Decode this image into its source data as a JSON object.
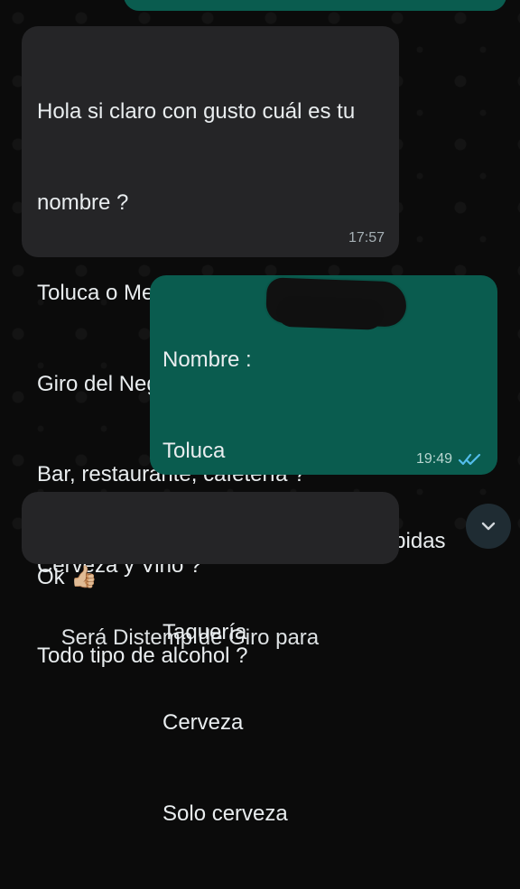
{
  "messages": [
    {
      "lines": [
        "Hola si claro con gusto cuál es tu",
        "nombre ?",
        "Toluca o Metepec ?",
        "Giro del Negocio ?",
        "Bar, restaurante, cafetería ?",
        "Cerveza y Vino ?",
        "Todo tipo de alcohol ?"
      ],
      "time": "17:57"
    },
    {
      "lines": [
        "Nombre :",
        "Toluca",
        "Venta de alimentos y bebidas",
        "Taquería",
        "Cerveza",
        "Solo cerveza"
      ],
      "time": "19:49",
      "status": "read"
    },
    {
      "lines": [
        "Ok 👍🏼",
        "Será Distemp de Giro para"
      ]
    }
  ],
  "icons": {
    "read_receipt": "double-check-icon",
    "scroll_down": "chevron-down-icon",
    "thumbs_up": "thumbs-up-icon"
  },
  "colors": {
    "incoming_bubble": "#252527",
    "outgoing_bubble": "#0a5c4f",
    "background": "#0b0b0b",
    "read_receipt": "#53bdeb"
  }
}
